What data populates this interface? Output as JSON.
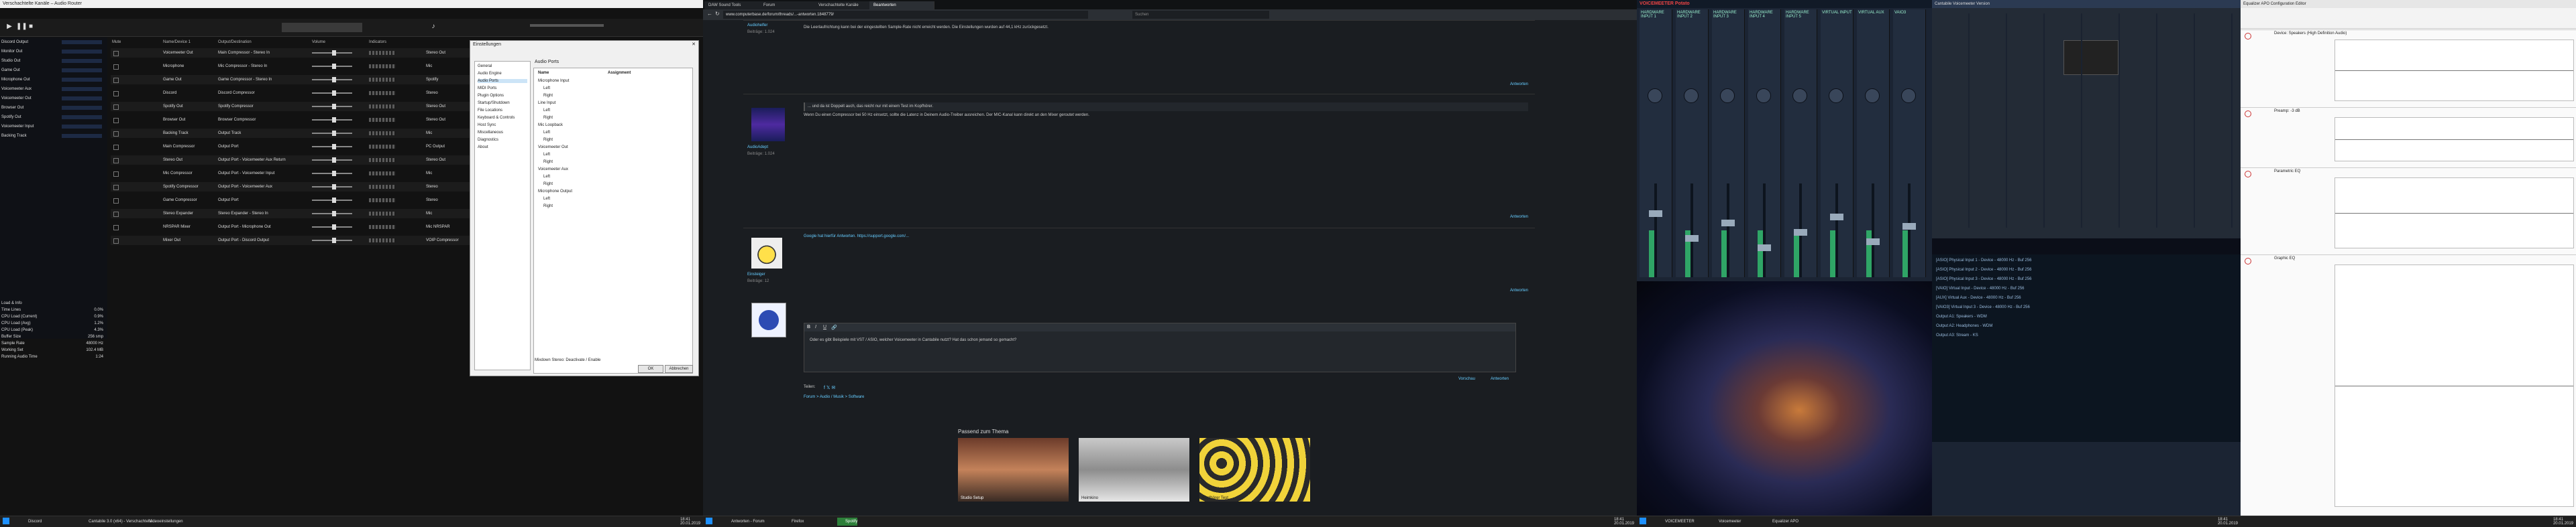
{
  "monitor1": {
    "title": "Verschachtelte Kanäle – Audio Router",
    "left_panel": [
      {
        "label": "Discord Output"
      },
      {
        "label": "Monitor Out"
      },
      {
        "label": "Studio Out"
      },
      {
        "label": "Game Out"
      },
      {
        "label": "Microphone Out"
      },
      {
        "label": "Voicemeeter Aux"
      },
      {
        "label": "Voicemeeter Out"
      },
      {
        "label": "Browser Out"
      },
      {
        "label": "Spotify Out"
      },
      {
        "label": "Voicemeeter Input"
      },
      {
        "label": "Backing Track"
      }
    ],
    "grid_headers": [
      "Mute",
      "Name/Device 1",
      "Output/Destination",
      "Volume",
      "Indicators"
    ],
    "rows": [
      {
        "c1": "Voicemeeter Out",
        "c2": "Main Compressor - Stereo In",
        "c3": "Stereo Out"
      },
      {
        "c1": "Microphone",
        "c2": "Mic Compressor - Stereo In",
        "c3": "Mic"
      },
      {
        "c1": "Game Out",
        "c2": "Game Compressor - Stereo In",
        "c3": "Spotify"
      },
      {
        "c1": "Discord",
        "c2": "Discord Compressor",
        "c3": "Stereo"
      },
      {
        "c1": "Spotify Out",
        "c2": "Spotify Compressor",
        "c3": "Stereo Out"
      },
      {
        "c1": "Browser Out",
        "c2": "Browser Compressor",
        "c3": "Stereo Out"
      },
      {
        "c1": "Backing Track",
        "c2": "Output Track",
        "c3": "Mic"
      },
      {
        "c1": "Main Compressor",
        "c2": "Output Port",
        "c3": "PC Output"
      },
      {
        "c1": "Stereo Out",
        "c2": "Output Port - Voicemeeter Aux Return",
        "c3": "Stereo Out"
      },
      {
        "c1": "Mic Compressor",
        "c2": "Output Port - Voicemeeter Input",
        "c3": "Mic"
      },
      {
        "c1": "Spotify Compressor",
        "c2": "Output Port - Voicemeeter Aux",
        "c3": "Stereo"
      },
      {
        "c1": "Game Compressor",
        "c2": "Output Port",
        "c3": "Stereo"
      },
      {
        "c1": "Stereo Expander",
        "c2": "Stereo Expander - Stereo In",
        "c3": "Mic"
      },
      {
        "c1": "NRSPAR Mixer",
        "c2": "Output Port - Microphone Out",
        "c3": "Mic NRSPAR"
      },
      {
        "c1": "Mixer Out",
        "c2": "Output Port - Discord Output",
        "c3": "VOIP Compressor"
      }
    ],
    "dialog": {
      "title": "Einstellungen",
      "menu": [
        "General",
        "Audio Engine",
        "Audio Ports",
        "MIDI Ports",
        "Plugin Options",
        "Startup/Shutdown",
        "File Locations",
        "Keyboard & Controls",
        "Host Sync",
        "Miscellaneous",
        "Diagnostics",
        "About"
      ],
      "selected": "Audio Ports",
      "panel_title": "Audio Ports",
      "panel_head": [
        "Name",
        "Assignment"
      ],
      "panel_rows": [
        "Microphone Input",
        "Left",
        "Right",
        "Line Input",
        "Left",
        "Right",
        "Mic Loopback",
        "Left",
        "Right",
        "Voicemeeter Out",
        "Left",
        "Right",
        "Voicemeeter Aux",
        "Left",
        "Right",
        "Microphone Output",
        "Left",
        "Right"
      ],
      "footer": "Mixdown Stereo: Deactivate / Enable",
      "buttons": [
        "OK",
        "Abbrechen"
      ]
    },
    "status": [
      {
        "k": "Load & Info",
        "v": ""
      },
      {
        "k": "Time Lines",
        "v": "0.0%"
      },
      {
        "k": "CPU Load (Current)",
        "v": "0.9%"
      },
      {
        "k": "CPU Load (Avg)",
        "v": "1.2%"
      },
      {
        "k": "CPU Load (Peak)",
        "v": "4.3%"
      },
      {
        "k": "Buffer Size",
        "v": "256 smp"
      },
      {
        "k": "Sample Rate",
        "v": "48000 Hz"
      },
      {
        "k": "Working Set",
        "v": "102.4 MB"
      },
      {
        "k": "Running Audio Time",
        "v": "1:24"
      }
    ],
    "taskbar": [
      "Discord",
      "Cantabile 3.0 (x64) - Verschachtelte...",
      "Videoeinstellungen"
    ],
    "clock": {
      "time": "18:41",
      "date": "20.01.2019"
    }
  },
  "monitor2": {
    "tabs": [
      "DAW Sound Tools",
      "Forum",
      "Verschachtelte Kanäle",
      "Beantworten"
    ],
    "active_tab": 3,
    "url": "www.computerbase.de/forum/threads/...-antworten.1848779/",
    "search_placeholder": "Suchen",
    "posts": [
      {
        "author": "Audiohelfer",
        "meta": "Beiträge: 1.024",
        "text": "Die Leerlaufrichtung kann bei der eingestellten Sample-Rate nicht erreicht werden. Die Einstellungen wurden auf 44,1 kHz zurückgesetzt.",
        "quote": "",
        "reply": "Antworten"
      },
      {
        "author": "AudioAdept",
        "meta": "Beiträge: 1.024",
        "text": "Wenn Du einen Compressor bei 50 Hz einsetzt, sollte die Latenz in Deinem Audio-Treiber ausreichen. Der MIC-Kanal kann direkt an den Mixer geroutet werden.",
        "quote": "... und da ist Doppelt auch, das reicht nur mit einem Test im Kopfhörer.",
        "reply": "Antworten"
      },
      {
        "author": "Einsteiger",
        "meta": "Beiträge: 12",
        "text": "Google hat hierfür Antworten. https://support.google.com/...",
        "quote": "",
        "reply": "Antworten"
      }
    ],
    "editor_text": "Oder es gibt Beispiele mit VST / ASIO, welcher Voicemeeter in Cantabile nutzt? Hat das schon jemand so gemacht?",
    "editor_buttons": [
      "Vorschau",
      "Antworten"
    ],
    "share_label": "Teilen:",
    "breadcrumb": [
      "Forum",
      "Audio / Musik",
      "Software"
    ],
    "related_title": "Passend zum Thema",
    "related": [
      "Studio Setup",
      "Heimkino",
      "Kopfhörer Test"
    ],
    "taskbar": [
      "Antworten - Forum",
      "Firefox",
      "Spotify"
    ],
    "clock": {
      "time": "18:41",
      "date": "20.01.2019"
    }
  },
  "monitor3": {
    "title": "VOICEMEETER Potato",
    "strip_labels": [
      "HARDWARE INPUT 1",
      "HARDWARE INPUT 2",
      "HARDWARE INPUT 3",
      "HARDWARE INPUT 4",
      "HARDWARE INPUT 5",
      "VIRTUAL INPUT",
      "VIRTUAL AUX",
      "VAIO3"
    ],
    "vm2_title": "Cantabile Voicemeeter Version",
    "patch_rows": [
      "[ASIO] Physical Input 1  -  Device  -  48000 Hz  -  Buf  256",
      "[ASIO] Physical Input 2  -  Device  -  48000 Hz  -  Buf  256",
      "[ASIO] Physical Input 3  -  Device  -  48000 Hz  -  Buf  256",
      "[VAIO] Virtual Input  -  Device  -  48000 Hz  -  Buf  256",
      "[AUX] Virtual Aux  -  Device  -  48000 Hz  -  Buf  256",
      "[VAIO3] Virtual Input 3  -  Device  -  48000 Hz  -  Buf  256",
      "Output A1: Speakers  -  WDM",
      "Output A2: Headphones  -  WDM",
      "Output A3: Stream  -  KS"
    ],
    "taskbar": [
      "VOICEMEETER",
      "Voicemeeter",
      "Equalizer APO"
    ],
    "clock": {
      "time": "18:41",
      "date": "20.01.2019"
    }
  },
  "monitor4": {
    "title": "Equalizer APO Configuration Editor",
    "blocks": [
      {
        "name": "Device: Speakers (High Definition Audio)"
      },
      {
        "name": "Preamp: -3 dB"
      },
      {
        "name": "Parametric EQ"
      },
      {
        "name": "Graphic EQ"
      }
    ],
    "taskbar_clock": {
      "time": "18:41",
      "date": "20.01.2019"
    }
  }
}
